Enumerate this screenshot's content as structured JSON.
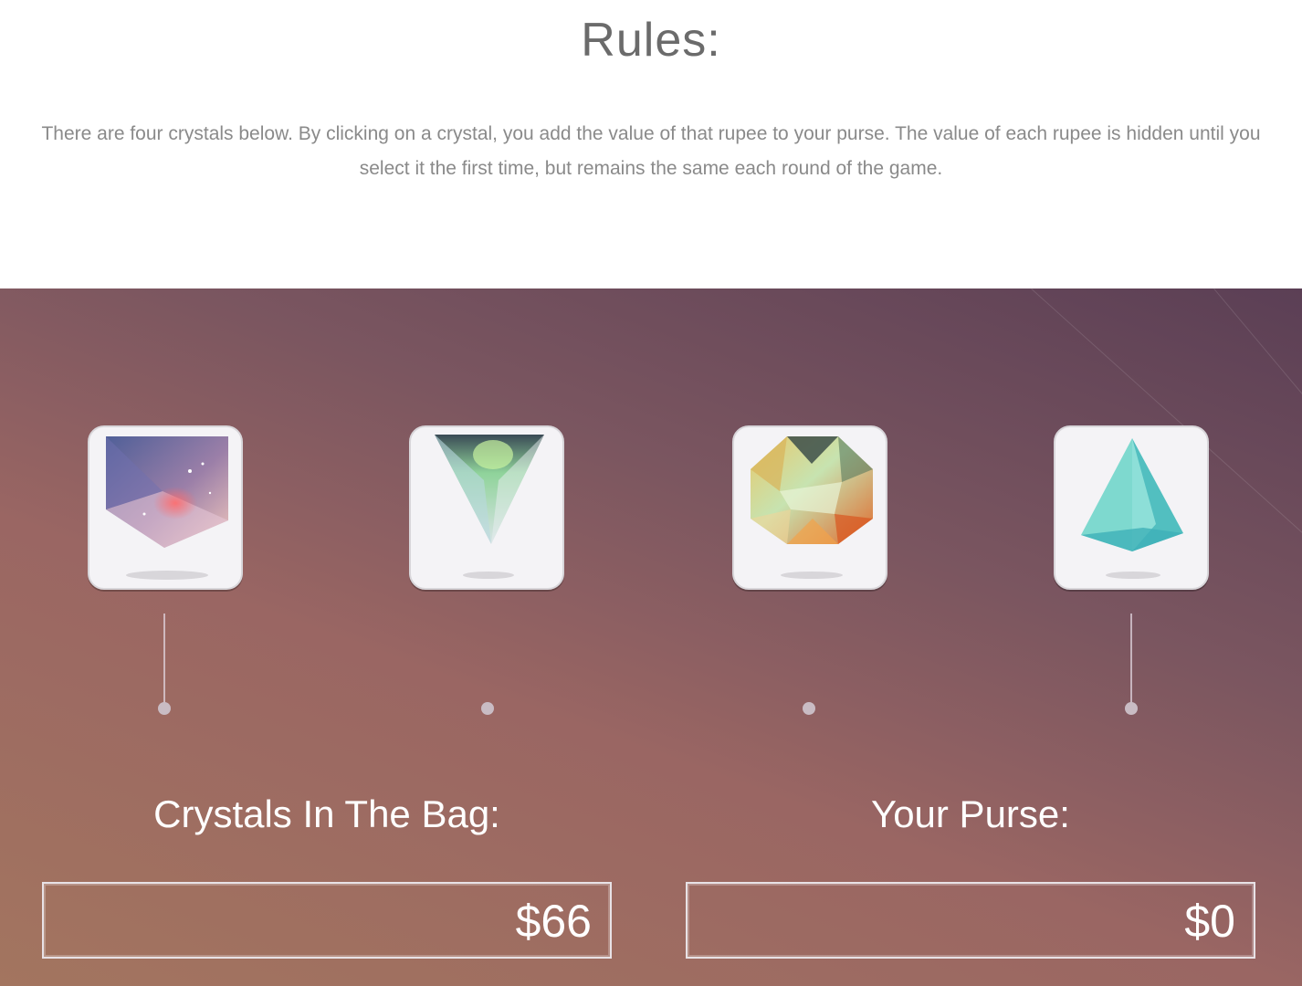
{
  "rules": {
    "title": "Rules:",
    "text": "There are four crystals below. By clicking on a crystal, you add the value of that rupee to your purse. The value of each rupee is hidden until you select it the first time, but remains the same each round of the game."
  },
  "crystals": [
    {
      "icon": "purple-pentagon-crystal-icon"
    },
    {
      "icon": "inverted-triangle-crystal-icon"
    },
    {
      "icon": "octagon-gem-crystal-icon"
    },
    {
      "icon": "teal-pyramid-crystal-icon"
    }
  ],
  "scores": {
    "bag_label": "Crystals In The Bag:",
    "bag_value": "$66",
    "purse_label": "Your Purse:",
    "purse_value": "$0"
  },
  "colors": {
    "gradient_dark": "#5b3f55",
    "gradient_mid": "#9a6663",
    "gradient_warm": "#a3755f",
    "card_bg": "#f4f3f6"
  }
}
